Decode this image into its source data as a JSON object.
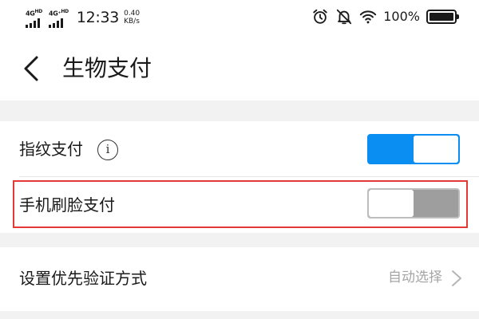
{
  "status_bar": {
    "sim1_label": "4G",
    "sim1_sup": "HD",
    "sim2_label": "4G⁺",
    "sim2_sup": "HD",
    "time": "12:33",
    "speed_value": "0.40",
    "speed_unit": "KB/s",
    "battery_percent": "100%"
  },
  "header": {
    "title": "生物支付"
  },
  "settings": {
    "fingerprint_pay": {
      "label": "指纹支付",
      "enabled": true
    },
    "face_pay": {
      "label": "手机刷脸支付",
      "enabled": false
    },
    "verify_method": {
      "label": "设置优先验证方式",
      "value": "自动选择"
    }
  },
  "colors": {
    "toggle_on": "#0a8ef2",
    "toggle_off": "#9e9e9e",
    "highlight": "#e53935"
  },
  "icons": [
    "back-arrow-icon",
    "info-icon",
    "alarm-clock-icon",
    "bell-off-icon",
    "wifi-icon",
    "battery-icon",
    "chevron-right-icon"
  ]
}
